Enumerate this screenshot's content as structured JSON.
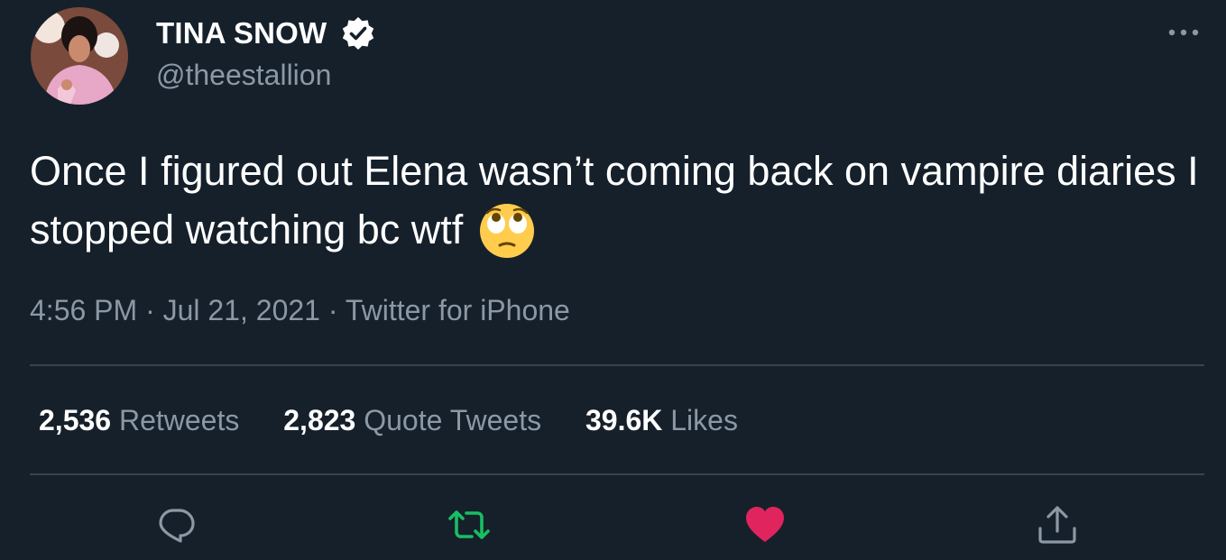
{
  "author": {
    "display_name": "TINA SNOW",
    "handle": "@theestallion",
    "verified": true,
    "avatar_icon": "profile-photo"
  },
  "tweet": {
    "text": "Once I figured out Elena wasn’t coming back on vampire diaries I stopped watching bc wtf",
    "emoji": "face-with-rolling-eyes"
  },
  "meta": {
    "time": "4:56 PM",
    "separator": " · ",
    "date": "Jul 21, 2021",
    "source": "Twitter for iPhone"
  },
  "stats": {
    "retweets": {
      "count": "2,536",
      "label": "Retweets"
    },
    "quotes": {
      "count": "2,823",
      "label": "Quote Tweets"
    },
    "likes": {
      "count": "39.6K",
      "label": "Likes"
    }
  },
  "actions": [
    {
      "name": "reply",
      "icon": "reply-icon"
    },
    {
      "name": "retweet",
      "icon": "retweet-icon",
      "color": "#17bf63"
    },
    {
      "name": "like",
      "icon": "heart-icon",
      "color": "#e0245e"
    },
    {
      "name": "share",
      "icon": "share-icon"
    }
  ],
  "colors": {
    "background": "#15202b",
    "secondary_text": "#8b98a5",
    "divider": "#38444d",
    "verified_badge": "#ffffff"
  }
}
